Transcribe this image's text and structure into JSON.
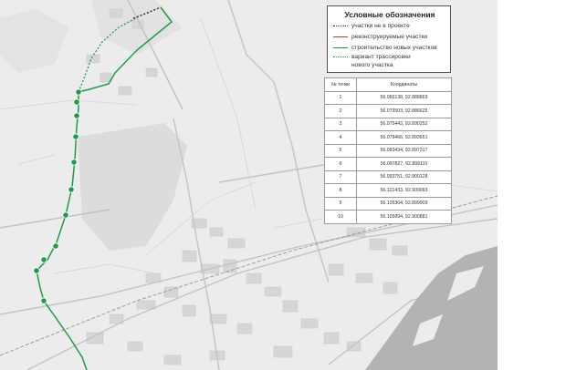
{
  "legend": {
    "title": "Условные обозначения",
    "items": [
      {
        "label": "участки не в проекте",
        "style": "dotted",
        "color": "#333333"
      },
      {
        "label": "реконструируемые участки",
        "style": "solid",
        "color": "#c0392b"
      },
      {
        "label": "строительство новых участков",
        "style": "solid",
        "color": "#1e9a4a"
      },
      {
        "label": "вариант трассировки",
        "style": "dotted",
        "color": "#1e9a4a"
      },
      {
        "label": "нового участка",
        "style": "none",
        "color": ""
      }
    ]
  },
  "coords_table": {
    "headers": [
      "№ точки",
      "Координаты"
    ],
    "rows": [
      [
        "1",
        "56.066138, 92.888869"
      ],
      [
        "2",
        "56.073503, 92.886625"
      ],
      [
        "3",
        "56.075443, 92.890252"
      ],
      [
        "4",
        "56.078466, 92.893651"
      ],
      [
        "5",
        "56.083434, 92.897317"
      ],
      [
        "6",
        "56.087827, 92.899110"
      ],
      [
        "7",
        "56.093751, 92.900128"
      ],
      [
        "8",
        "56.101433, 92.900093"
      ],
      [
        "9",
        "56.105364, 92.899909"
      ],
      [
        "10",
        "56.105894, 92.900881"
      ]
    ]
  },
  "colors": {
    "route": "#1e9a4a",
    "water": "#b3b3b3",
    "land": "#ececec",
    "roads": "#c9c9c9"
  }
}
